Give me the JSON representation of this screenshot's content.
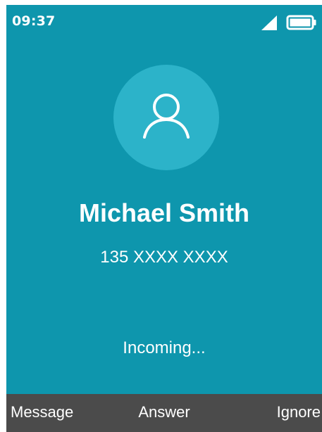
{
  "status_bar": {
    "time": "09:37",
    "signal_icon": "cellular-signal-icon",
    "battery_icon": "battery-full-icon"
  },
  "caller": {
    "avatar_icon": "person-icon",
    "name": "Michael Smith",
    "number": "135 XXXX XXXX"
  },
  "call_status": "Incoming...",
  "softkeys": {
    "left": "Message",
    "center": "Answer",
    "right": "Ignore"
  },
  "colors": {
    "background": "#0e96ad",
    "avatar_circle": "#2cb3c9",
    "softkey_bar": "#4b4b4b",
    "text": "#ffffff"
  }
}
